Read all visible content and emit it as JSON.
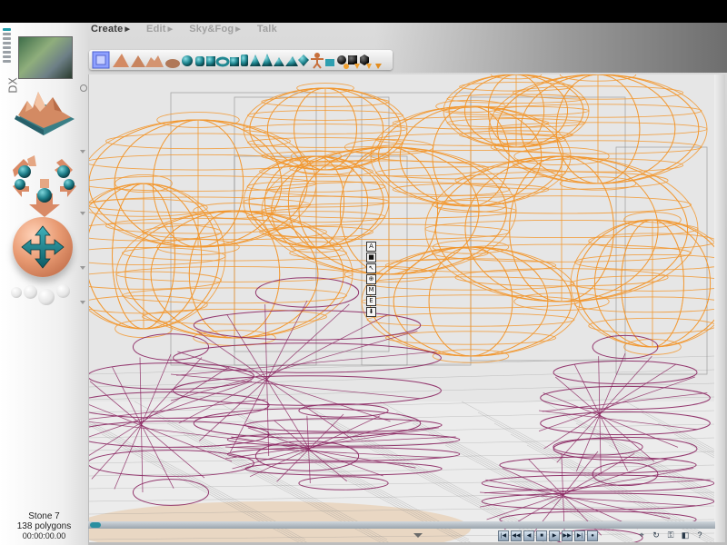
{
  "menu": {
    "items": [
      {
        "label": "Create",
        "enabled": true
      },
      {
        "label": "Edit",
        "enabled": false
      },
      {
        "label": "Sky&Fog",
        "enabled": false
      },
      {
        "label": "Talk",
        "enabled": false
      }
    ]
  },
  "toolbar": {
    "tools": [
      "select-tool",
      "pyramid-terrain",
      "cone-terrain",
      "mountain-terrain",
      "rock",
      "sphere",
      "cylinder",
      "cube",
      "torus",
      "cube2",
      "cylinder2",
      "pyramid",
      "cone",
      "cone2",
      "prism",
      "prism2",
      "figure",
      "water",
      "black-sphere",
      "black-cube",
      "black-hex",
      "orange-drop",
      "orange-cone",
      "orange-cone2",
      "orange-diamond"
    ]
  },
  "left_panel": {
    "label_dx": "DX"
  },
  "status": {
    "object_name": "Stone 7",
    "polygons": "138 polygons",
    "time": "00:00:00.00"
  },
  "mini_toolbar": [
    "A",
    "■",
    "↖",
    "⊕",
    "M",
    "E",
    "⬇"
  ],
  "colors": {
    "wire_orange": "#f2962e",
    "wire_purple": "#8a2460",
    "wire_grey": "#8c8c8c",
    "accent_teal": "#1e9aa8",
    "terracotta": "#d98a66"
  },
  "transport": [
    "|◀",
    "◀◀",
    "◀",
    "■",
    "▶",
    "▶▶",
    "▶|",
    "●"
  ],
  "timeline": {
    "position": 0.0
  }
}
